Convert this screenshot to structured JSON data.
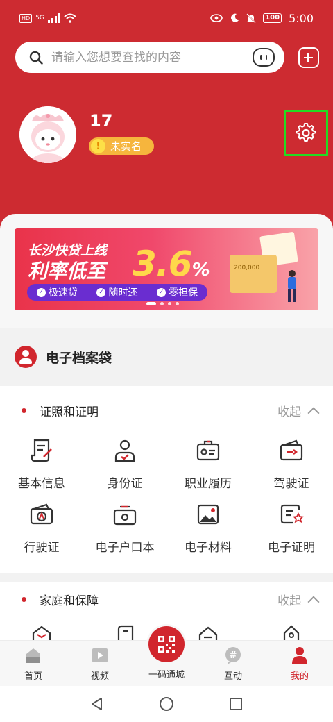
{
  "status_bar": {
    "network_tag": "HD",
    "signal": "5G",
    "battery": "100",
    "time": "5:00"
  },
  "search": {
    "placeholder": "请输入您想要查找的内容"
  },
  "user": {
    "number": "17",
    "verify_badge": "未实名",
    "badge_icon": "!"
  },
  "banner": {
    "line1": "长沙快贷上线",
    "line2": "利率低至",
    "rate": "3.6",
    "rate_unit": "%",
    "box_amount": "200,000",
    "features": [
      "极速贷",
      "随时还",
      "零担保"
    ]
  },
  "archive": {
    "title": "电子档案袋"
  },
  "groups": [
    {
      "title": "证照和证明",
      "collapse_label": "收起",
      "items": [
        {
          "label": "基本信息",
          "icon": "basic-info-icon"
        },
        {
          "label": "身份证",
          "icon": "id-card-icon"
        },
        {
          "label": "职业履历",
          "icon": "career-icon"
        },
        {
          "label": "驾驶证",
          "icon": "driver-license-icon"
        },
        {
          "label": "行驶证",
          "icon": "vehicle-license-icon"
        },
        {
          "label": "电子户口本",
          "icon": "household-register-icon"
        },
        {
          "label": "电子材料",
          "icon": "e-material-icon"
        },
        {
          "label": "电子证明",
          "icon": "e-certificate-icon"
        }
      ]
    },
    {
      "title": "家庭和保障",
      "collapse_label": "收起"
    }
  ],
  "tabbar": {
    "items": [
      {
        "label": "首页",
        "icon": "home-icon"
      },
      {
        "label": "视频",
        "icon": "video-icon"
      },
      {
        "label": "一码通城",
        "icon": "qr-code-icon"
      },
      {
        "label": "互动",
        "icon": "interact-icon"
      },
      {
        "label": "我的",
        "icon": "profile-icon"
      }
    ],
    "active_color": "#d1262d"
  },
  "colors": {
    "brand_red": "#cd2b31",
    "highlight_box": "#22dd22"
  }
}
